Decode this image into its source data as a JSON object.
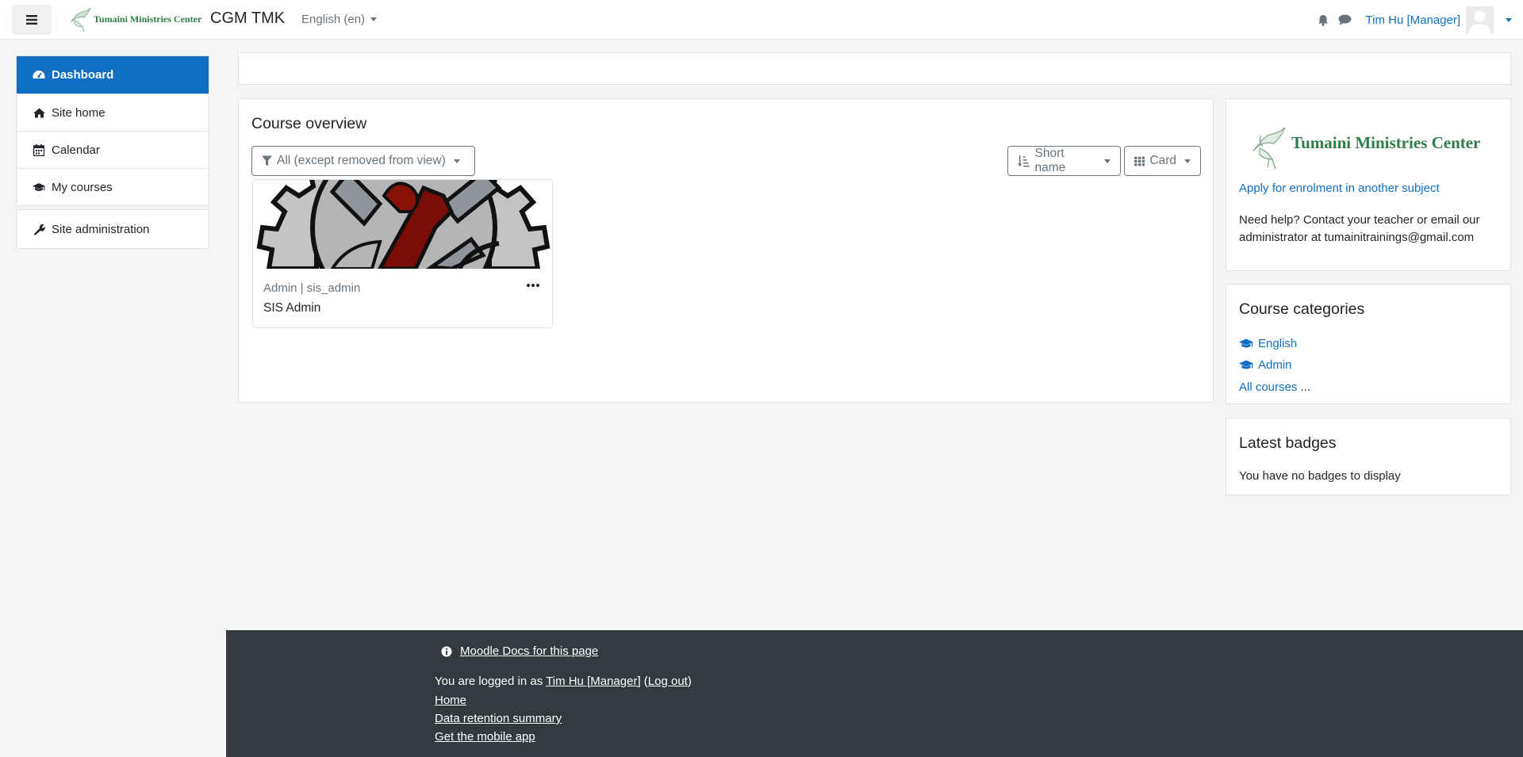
{
  "navbar": {
    "logo_text": "Tumaini Ministries Center",
    "site_name": "CGM TMK",
    "language": "English (en)",
    "user_name": "Tim Hu [Manager]"
  },
  "drawer": {
    "items": [
      {
        "label": "Dashboard",
        "icon": "dashboard-icon"
      },
      {
        "label": "Site home",
        "icon": "home-icon"
      },
      {
        "label": "Calendar",
        "icon": "calendar-icon"
      },
      {
        "label": "My courses",
        "icon": "graduation-cap-icon"
      }
    ],
    "admin": {
      "label": "Site administration",
      "icon": "wrench-icon"
    }
  },
  "course_overview": {
    "title": "Course overview",
    "filter_label": "All (except removed from view)",
    "sort_label": "Short name",
    "view_label": "Card",
    "courses": [
      {
        "category": "Admin | sis_admin",
        "name": "SIS Admin"
      }
    ]
  },
  "html_block": {
    "logo_text": "Tumaini Ministries Center",
    "apply_link": "Apply for enrolment in another subject",
    "help_text": "Need help? Contact your teacher or email our administrator at tumainitrainings@gmail.com"
  },
  "categories_block": {
    "title": "Course categories",
    "items": [
      "English",
      "Admin"
    ],
    "all_courses": "All courses",
    "ellipsis": "..."
  },
  "badges_block": {
    "title": "Latest badges",
    "text": "You have no badges to display"
  },
  "footer": {
    "docs_link": "Moodle Docs for this page",
    "logged_prefix": "You are logged in as ",
    "logged_user": "Tim Hu [Manager]",
    "logout_open": " (",
    "logout": "Log out",
    "logout_close": ")",
    "home": "Home",
    "data_retention": "Data retention summary",
    "mobile_app": "Get the mobile app"
  },
  "colors": {
    "primary": "#0f6fc5",
    "footer_bg": "#343a40",
    "brand_green": "#2e7d4a",
    "page_bg": "#f5f5f5"
  }
}
